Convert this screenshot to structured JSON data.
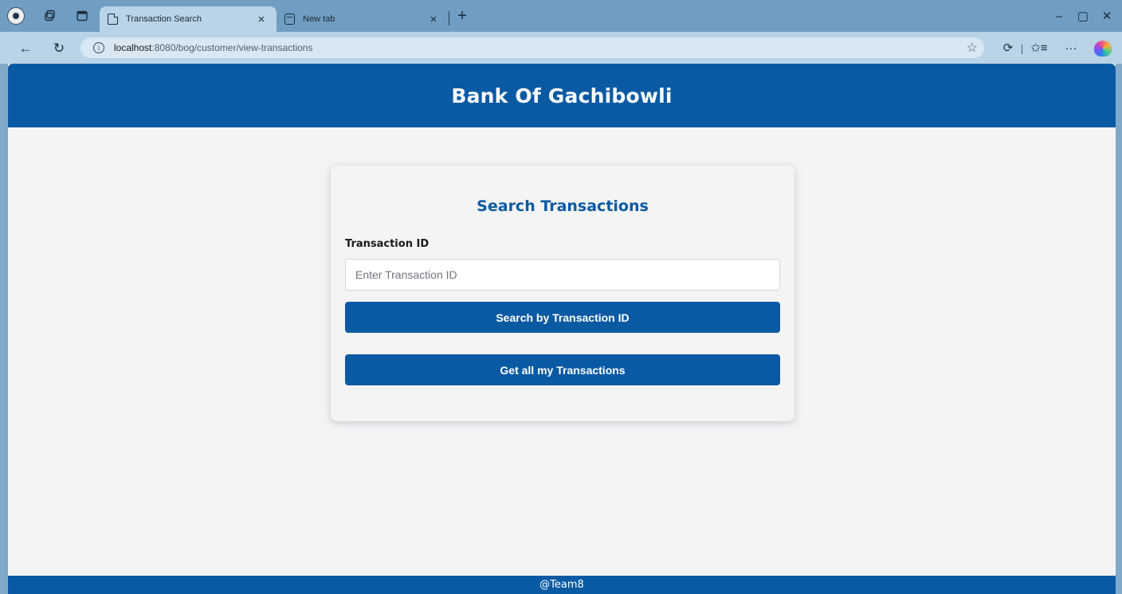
{
  "browser": {
    "tabs": [
      {
        "title": "Transaction Search",
        "active": true,
        "icon": "page-icon"
      },
      {
        "title": "New tab",
        "active": false,
        "icon": "new-tab-page-icon"
      }
    ],
    "tab_close_glyph": "×",
    "new_tab_glyph": "+",
    "window": {
      "minimize": "–",
      "maximize": "▢",
      "close": "✕"
    },
    "nav": {
      "back": "←",
      "reload": "↻"
    },
    "address": {
      "host": "localhost",
      "rest": ":8080/bog/customer/view-transactions"
    },
    "toolbar_glyphs": {
      "favorite": "☆",
      "extensions": "⟳",
      "favorites_bar": "✩≡",
      "more": "···",
      "info": "i"
    }
  },
  "site": {
    "title": "Bank Of Gachibowli",
    "footer": "@Team8"
  },
  "search_card": {
    "title": "Search Transactions",
    "field_label": "Transaction ID",
    "field_placeholder": "Enter Transaction ID",
    "field_value": "",
    "search_button": "Search by Transaction ID",
    "all_button": "Get all my Transactions"
  },
  "colors": {
    "brand": "#0a5aa3",
    "page_bg": "#f4f4f7",
    "card_bg": "#f4f4f4",
    "chrome_tabbar": "#6f9ec2",
    "chrome_toolbar": "#b9d3e7"
  }
}
